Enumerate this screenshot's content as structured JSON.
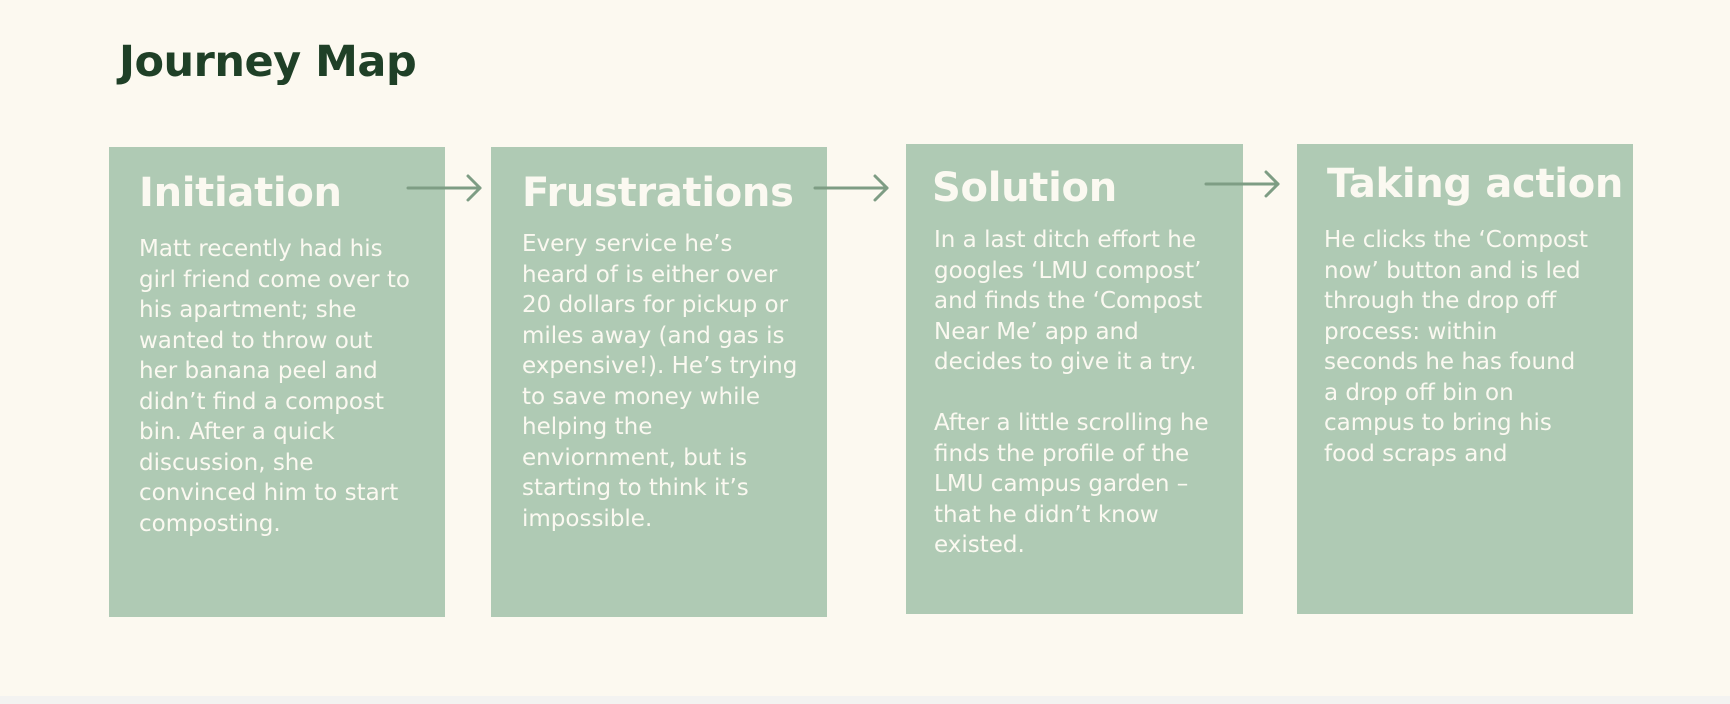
{
  "title": "Journey Map",
  "colors": {
    "background": "#fcf9f0",
    "card": "#afcab4",
    "card_text": "#fbf9f1",
    "title": "#1f4027",
    "arrow": "#7e9d84"
  },
  "stages": [
    {
      "title": "Initiation",
      "body": "Matt recently had his\ngirl friend come over to\nhis apartment; she\nwanted to throw out\nher banana peel and\ndidn’t find a compost\nbin. After a quick\ndiscussion, she\nconvinced him to start\ncomposting."
    },
    {
      "title": "Frustrations",
      "body": "Every service he’s\nheard of is either over\n20 dollars for pickup or\nmiles away (and gas is\nexpensive!). He’s trying\nto save money while\nhelping the\nenviornment, but is\nstarting to think it’s\nimpossible."
    },
    {
      "title": "Solution",
      "body": "In a last ditch effort he\ngoogles ‘LMU compost’\nand finds the ‘Compost\nNear Me’ app and\ndecides to give it a try.\n\nAfter a little scrolling he\nfinds the profile of the\nLMU campus garden –\nthat he didn’t know\nexisted."
    },
    {
      "title": "Taking action",
      "body": "He clicks the ‘Compost\nnow’ button and is led\nthrough the drop off\nprocess: within\nseconds he has found\na drop off bin on\ncampus to bring his\nfood scraps and"
    }
  ]
}
